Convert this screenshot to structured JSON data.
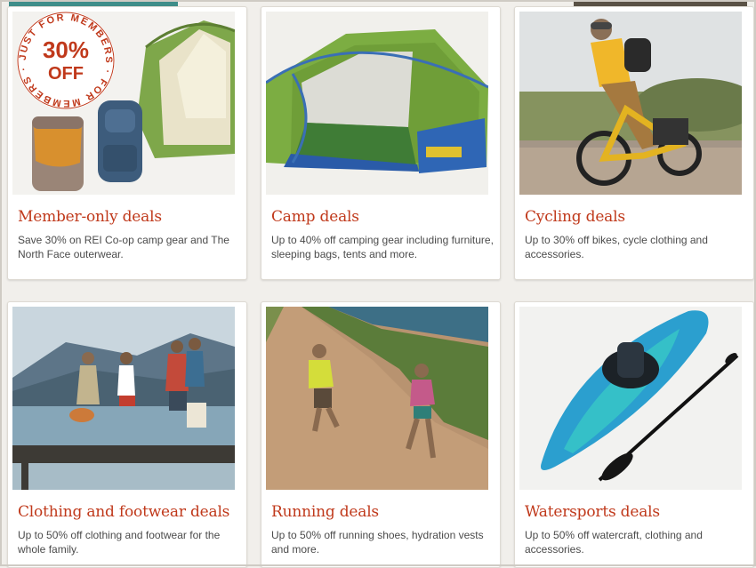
{
  "cards": [
    {
      "title": "Member-only deals",
      "description": "Save 30% on REI Co-op camp gear and The North Face outerwear.",
      "badge": {
        "percent": "30%",
        "off": "OFF",
        "ring_text": "JUST FOR MEMBERS · FOR MEMBERS ·"
      }
    },
    {
      "title": "Camp deals",
      "description": "Up to 40% off camping gear including furniture, sleeping bags, tents and more."
    },
    {
      "title": "Cycling deals",
      "description": "Up to 30% off bikes, cycle clothing and accessories."
    },
    {
      "title": "Clothing and footwear deals",
      "description": "Up to 50% off clothing and footwear for the whole family."
    },
    {
      "title": "Running deals",
      "description": "Up to 50% off running shoes, hydration vests and more."
    },
    {
      "title": "Watersports deals",
      "description": "Up to 50% off watercraft, clothing and accessories."
    }
  ],
  "colors": {
    "title": "#c0391b",
    "description": "#4b4b4b",
    "badge": "#c0391b",
    "background": "#f1efeb"
  }
}
